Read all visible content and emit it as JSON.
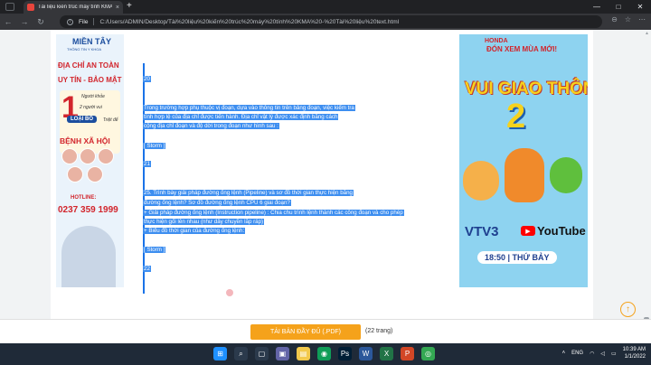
{
  "browser": {
    "tab_title": "Tài liệu kiến trúc máy tính KMA",
    "tab_close": "×",
    "new_tab": "+",
    "nav": {
      "back": "←",
      "forward": "→",
      "reload": "↻"
    },
    "omnibox": {
      "info": "i",
      "scheme": "File",
      "url": "C:/Users/ADMIN/Desktop/Tài%20liệu%20kiến%20trúc%20máy%20tính%20KMA%20-%20Tài%20liệu%20text.html"
    },
    "window_controls": {
      "minimize": "—",
      "maximize": "□",
      "close": "✕"
    },
    "toolbar_icons": {
      "zoom": "⊖",
      "star": "☆",
      "more": "⋯"
    }
  },
  "ad_left": {
    "brand": "MIỀN TÂY",
    "brand_sub": "THÔNG TIN Y KHOA",
    "line1": "ĐỊA CHỈ AN TOÀN",
    "line2": "UY TÍN - BẢO MẬT",
    "number": "1",
    "note1": "Người khỏe",
    "note2": "2 người vui",
    "badge": "LOẠI BỎ",
    "note3": "Triệt để",
    "disease": "BỆNH XÃ HỘI",
    "hotline_label": "HOTLINE:",
    "phone": "0237 359 1999"
  },
  "ad_right": {
    "brand": "HONDA",
    "tag": "ĐÓN XEM MÙA MỚI!",
    "title": "VUI GIAO THÔNG",
    "number": "2",
    "channel": "VTV3",
    "youtube": "YouTube",
    "schedule": "18:50 | THỨ BẢY"
  },
  "content": {
    "lines": [
      "20",
      "Trong trường hợp phụ thuộc vị đoạn, dựa vào thông tin trên bảng đoạn, việc kiểm tra",
      "tính hợp lệ của địa chỉ được tiến hành. Địa chỉ vật lý được xác định bằng cách",
      "cộng địa chỉ đoạn và độ dời trong đoạn như hình sau :",
      "[ Storm ]",
      "21",
      "25. Trình bày giải pháp đường ống lệnh (Pipeline) và sơ đồ thời gian thực hiện bằng",
      "đường ống lệnh? Sơ đồ đường ống lệnh CPU 6 giai đoạn?",
      "+ Giải pháp đường ống lệnh (Instruction pipeline) : Chia chu trình lệnh thành các công đoạn và cho phép",
      "thực hiện gối lên nhau (như dây chuyền lắp ráp)",
      "+ Biểu đồ thời gian của đường ống lệnh:",
      "[ Storm ]",
      "22"
    ]
  },
  "download": {
    "button": "TẢI BẢN ĐẦY ĐỦ (.PDF)",
    "pages": "(22 trang)",
    "up_arrow": "↑"
  },
  "taskbar": {
    "lang": "ENG",
    "time": "10:39 AM",
    "date": "1/1/2022",
    "icons": [
      "⊞",
      "⌕",
      "▢",
      "▣",
      "▤",
      "◉",
      "Ps",
      "W",
      "X",
      "P",
      "◎"
    ]
  },
  "colors": {
    "accent": "#f5a21b",
    "selection": "#3d8ef0"
  }
}
